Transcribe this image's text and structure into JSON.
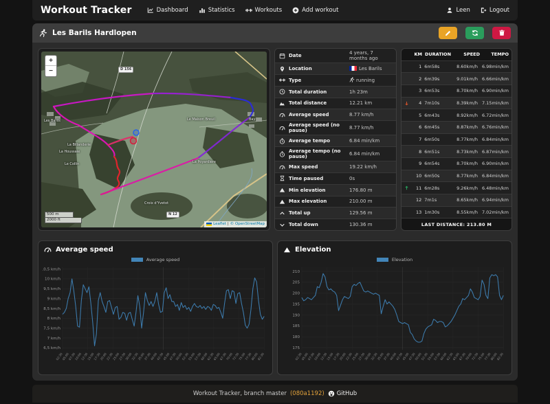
{
  "navbar": {
    "brand": "Workout Tracker",
    "items": [
      {
        "icon": "chart-line",
        "label": "Dashboard"
      },
      {
        "icon": "chart-bar",
        "label": "Statistics"
      },
      {
        "icon": "dumbbell",
        "label": "Workouts"
      },
      {
        "icon": "plus-circle",
        "label": "Add workout"
      }
    ],
    "user": {
      "icon": "person",
      "label": "Leen"
    },
    "logout": {
      "icon": "sign-out",
      "label": "Logout"
    }
  },
  "header": {
    "title": "Les Barils Hardlopen",
    "buttons": [
      {
        "name": "edit",
        "icon": "pencil",
        "color": "#e9a426"
      },
      {
        "name": "refresh",
        "icon": "refresh",
        "color": "#2a9d5c"
      },
      {
        "name": "delete",
        "icon": "trash",
        "color": "#ce1843"
      }
    ]
  },
  "map": {
    "zoom_in": "+",
    "zoom_out": "−",
    "scale_metric": "500 m",
    "scale_imperial": "2000 ft",
    "attribution": {
      "leaflet": "Leaflet",
      "sep": "|",
      "osm": "© OpenStreetMap"
    },
    "badges": [
      "D 156",
      "N 12"
    ],
    "places": [
      "Les Barils",
      "Bay",
      "Le Maison Breuil",
      "La Poyardière",
      "La Houssaie",
      "Le Collin",
      "La Billanderie",
      "Croix d'Yvetot"
    ]
  },
  "details": {
    "rows": [
      {
        "icon": "calendar",
        "label": "Date",
        "value": "4 years, 7 months ago"
      },
      {
        "icon": "location",
        "label": "Location",
        "value": "Les Barils",
        "value_icon": "flag-fr"
      },
      {
        "icon": "dumbbell",
        "label": "Type",
        "value": "running",
        "value_icon": "runner"
      },
      {
        "icon": "clock",
        "label": "Total duration",
        "value": "1h 23m"
      },
      {
        "icon": "route",
        "label": "Total distance",
        "value": "12.21 km"
      },
      {
        "icon": "speedometer",
        "label": "Average speed",
        "value": "8.77 km/h"
      },
      {
        "icon": "speedometer",
        "label": "Average speed (no pause)",
        "value": "8.77 km/h"
      },
      {
        "icon": "stopwatch",
        "label": "Average tempo",
        "value": "6.84 min/km"
      },
      {
        "icon": "stopwatch",
        "label": "Average tempo (no pause)",
        "value": "6.84 min/km"
      },
      {
        "icon": "speedometer",
        "label": "Max speed",
        "value": "19.22 km/h"
      },
      {
        "icon": "hourglass",
        "label": "Time paused",
        "value": "0s"
      },
      {
        "icon": "mountain",
        "label": "Min elevation",
        "value": "176.80 m"
      },
      {
        "icon": "mountain",
        "label": "Max elevation",
        "value": "210.00 m"
      },
      {
        "icon": "chevron-up",
        "label": "Total up",
        "value": "129.56 m"
      },
      {
        "icon": "chevron-down",
        "label": "Total down",
        "value": "130.36 m"
      }
    ]
  },
  "splits": {
    "columns": [
      "KM",
      "DURATION",
      "SPEED",
      "TEMPO"
    ],
    "rows": [
      {
        "km": "1",
        "duration": "6m58s",
        "speed": "8.60km/h",
        "tempo": "6.98min/km",
        "trend": ""
      },
      {
        "km": "2",
        "duration": "6m39s",
        "speed": "9.01km/h",
        "tempo": "6.66min/km",
        "trend": ""
      },
      {
        "km": "3",
        "duration": "6m53s",
        "speed": "8.70km/h",
        "tempo": "6.90min/km",
        "trend": ""
      },
      {
        "km": "4",
        "duration": "7m10s",
        "speed": "8.39km/h",
        "tempo": "7.15min/km",
        "trend": "down"
      },
      {
        "km": "5",
        "duration": "6m43s",
        "speed": "8.92km/h",
        "tempo": "6.72min/km",
        "trend": ""
      },
      {
        "km": "6",
        "duration": "6m45s",
        "speed": "8.87km/h",
        "tempo": "6.76min/km",
        "trend": ""
      },
      {
        "km": "7",
        "duration": "6m50s",
        "speed": "8.77km/h",
        "tempo": "6.84min/km",
        "trend": ""
      },
      {
        "km": "8",
        "duration": "6m51s",
        "speed": "8.73km/h",
        "tempo": "6.87min/km",
        "trend": ""
      },
      {
        "km": "9",
        "duration": "6m54s",
        "speed": "8.70km/h",
        "tempo": "6.90min/km",
        "trend": ""
      },
      {
        "km": "10",
        "duration": "6m50s",
        "speed": "8.77km/h",
        "tempo": "6.84min/km",
        "trend": ""
      },
      {
        "km": "11",
        "duration": "6m28s",
        "speed": "9.26km/h",
        "tempo": "6.48min/km",
        "trend": "up"
      },
      {
        "km": "12",
        "duration": "7m1s",
        "speed": "8.65km/h",
        "tempo": "6.94min/km",
        "trend": ""
      },
      {
        "km": "13",
        "duration": "1m30s",
        "speed": "8.55km/h",
        "tempo": "7.02min/km",
        "trend": ""
      }
    ],
    "footer": "LAST DISTANCE: 213.80 M",
    "trend_up_color": "#28a35e",
    "trend_down_color": "#d9542b"
  },
  "chart_data": [
    {
      "type": "line",
      "title": "Average speed",
      "title_icon": "speedometer",
      "legend": "Average speed",
      "legend_color": "#4285b8",
      "line_color": "#3d7cae",
      "ylabel_unit": "km/h",
      "ylim": [
        6.4,
        10.6
      ],
      "yticks": {
        "values": [
          10.5,
          10,
          9.5,
          9,
          8.5,
          8,
          7.5,
          7,
          6.5
        ],
        "labels": [
          "10,5 km/h",
          "10 km/h",
          "9,5 km/h",
          "9 km/h",
          "8,5 km/h",
          "8 km/h",
          "7,5 km/h",
          "7 km/h",
          "6,5 km/h"
        ]
      },
      "xticks": [
        "02:30",
        "05:00",
        "07:30",
        "10:00",
        "12:30",
        "15:00",
        "17:30",
        "20:00",
        "22:30",
        "25:00",
        "27:30",
        "30:00",
        "32:30",
        "35:00",
        "37:30",
        "40:00",
        "42:30",
        "45:00",
        "47:30",
        "50:00",
        "52:30",
        "55:00",
        "57:30",
        "60:00",
        "62:30",
        "65:00",
        "67:30",
        "70:00",
        "72:30",
        "75:00",
        "77:30",
        "80:00",
        "82:30"
      ],
      "values": [
        8.2,
        8.3,
        8.5,
        9.0,
        9.3,
        10.0,
        9.4,
        8.6,
        7.6,
        7.55,
        8.9,
        9.7,
        9.5,
        9.3,
        9.6,
        8.8,
        7.8,
        6.6,
        7.2,
        8.9,
        9.3,
        8.85,
        8.6,
        8.3,
        8.85,
        8.9,
        8.55,
        8.2,
        8.55,
        8.6,
        7.95,
        8.05,
        8.3,
        8.25,
        7.9,
        8.25,
        8.3,
        7.95,
        7.6,
        8.3,
        9.15,
        8.6,
        7.5,
        8.3,
        9.3,
        8.9,
        8.65,
        8.85,
        8.6,
        8.85,
        9.3,
        8.7,
        8.3,
        8.35,
        9.3,
        9.55,
        9.0,
        9.2,
        8.85,
        8.85,
        8.6,
        8.7,
        8.4,
        8.8,
        8.55,
        8.65,
        8.45,
        8.55,
        8.35,
        8.6,
        8.75,
        8.6,
        8.55,
        8.65,
        8.5,
        8.6,
        8.45,
        8.6,
        8.55,
        8.4,
        8.7,
        8.65,
        8.5,
        8.55,
        8.3,
        8.0,
        8.75,
        9.4,
        9.45,
        9.0,
        9.4,
        9.35,
        8.75,
        9.25,
        9.3,
        8.75,
        8.3,
        7.65,
        7.5,
        7.7,
        8.45,
        9.5,
        10.05,
        9.85,
        8.9,
        8.2,
        7.95,
        8.1
      ]
    },
    {
      "type": "line",
      "title": "Elevation",
      "title_icon": "mountain",
      "legend": "Elevation",
      "legend_color": "#4285b8",
      "line_color": "#3d7cae",
      "ylabel_unit": "m",
      "ylim": [
        174,
        212
      ],
      "yticks": {
        "values": [
          210,
          205,
          200,
          195,
          190,
          185,
          180,
          175
        ],
        "labels": [
          "210",
          "205",
          "200",
          "195",
          "190",
          "185",
          "180",
          "175"
        ]
      },
      "xticks": [
        "02:30",
        "05:00",
        "07:30",
        "10:00",
        "12:30",
        "15:00",
        "17:30",
        "20:00",
        "22:30",
        "25:00",
        "27:30",
        "30:00",
        "32:30",
        "35:00",
        "37:30",
        "40:00",
        "42:30",
        "45:00",
        "47:30",
        "50:00",
        "52:30",
        "55:00",
        "57:30",
        "60:00",
        "62:30",
        "65:00",
        "67:30",
        "70:00",
        "72:30",
        "75:00",
        "77:30",
        "80:00",
        "82:30"
      ],
      "values": [
        198,
        196.5,
        197,
        198,
        197.5,
        197,
        198,
        199,
        203,
        202.5,
        205,
        209,
        207.5,
        203,
        201.5,
        202,
        201,
        200.5,
        199,
        192,
        194.5,
        197,
        198.5,
        198,
        197.5,
        198.5,
        203,
        204,
        203.5,
        204.5,
        205,
        203,
        201,
        200.5,
        201,
        200.5,
        200,
        199.5,
        200,
        199.5,
        199,
        190.5,
        194,
        197,
        195,
        196,
        195,
        194,
        192.5,
        190,
        187,
        186.5,
        186,
        186.5,
        186,
        185.5,
        182,
        181,
        179,
        178,
        177.5,
        177.5,
        178,
        181.5,
        183.5,
        184.5,
        185,
        185.5,
        188,
        187.5,
        186.5,
        187,
        187,
        186.5,
        184.5,
        185,
        186,
        187,
        188.5,
        190,
        192,
        194,
        195,
        197.5,
        197,
        198,
        199,
        202,
        200.5,
        198,
        197.5,
        197,
        198.5,
        206,
        204,
        199,
        197.5,
        207,
        208.5,
        208,
        208.5,
        207.5,
        199,
        197,
        199
      ]
    }
  ],
  "footer": {
    "prefix": "Workout Tracker, branch master",
    "hash": "(080a1192)",
    "github_icon": "github",
    "github_label": "GitHub"
  }
}
